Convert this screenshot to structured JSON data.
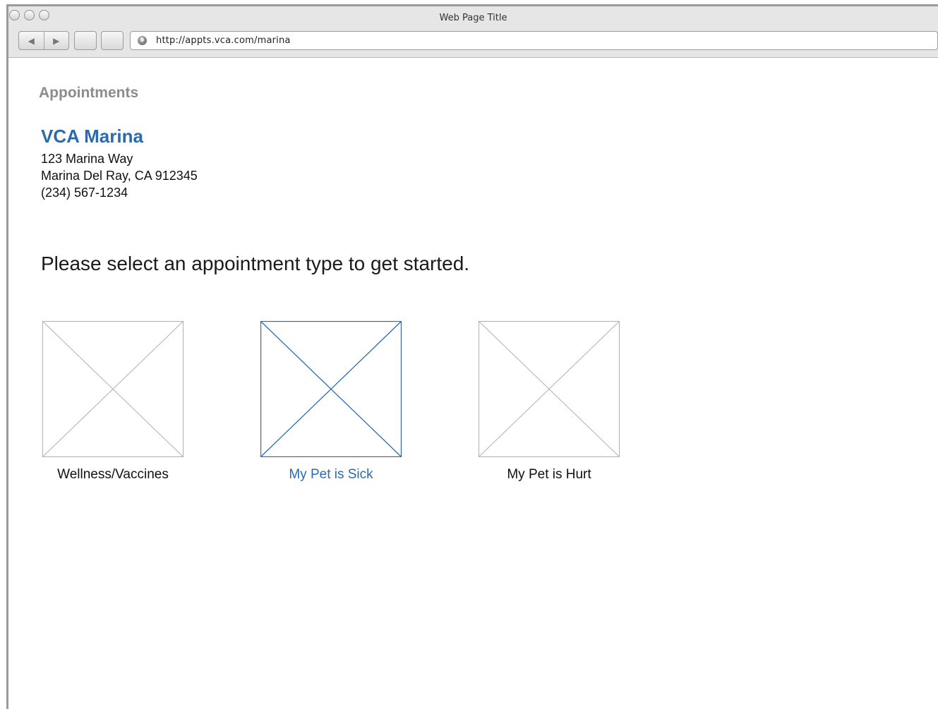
{
  "browser": {
    "window_title": "Web Page Title",
    "url": "http://appts.vca.com/marina",
    "nav_back_glyph": "◀",
    "nav_forward_glyph": "▶"
  },
  "page": {
    "section_heading": "Appointments",
    "clinic": {
      "name": "VCA Marina",
      "address_line1": "123 Marina Way",
      "address_line2": "Marina Del Ray, CA 912345",
      "phone": "(234) 567-1234"
    },
    "prompt": "Please select an appointment type to get started.",
    "appointment_types": [
      {
        "label": "Wellness/Vaccines",
        "selected": false
      },
      {
        "label": "My Pet is Sick",
        "selected": true
      },
      {
        "label": "My Pet is Hurt",
        "selected": false
      }
    ]
  },
  "colors": {
    "accent": "#2a6bb0",
    "placeholder_stroke": "#b0b0b0",
    "heading_gray": "#8c8c8c"
  },
  "icons": [
    "back-arrow-icon",
    "forward-arrow-icon",
    "globe-icon",
    "image-placeholder-icon"
  ]
}
